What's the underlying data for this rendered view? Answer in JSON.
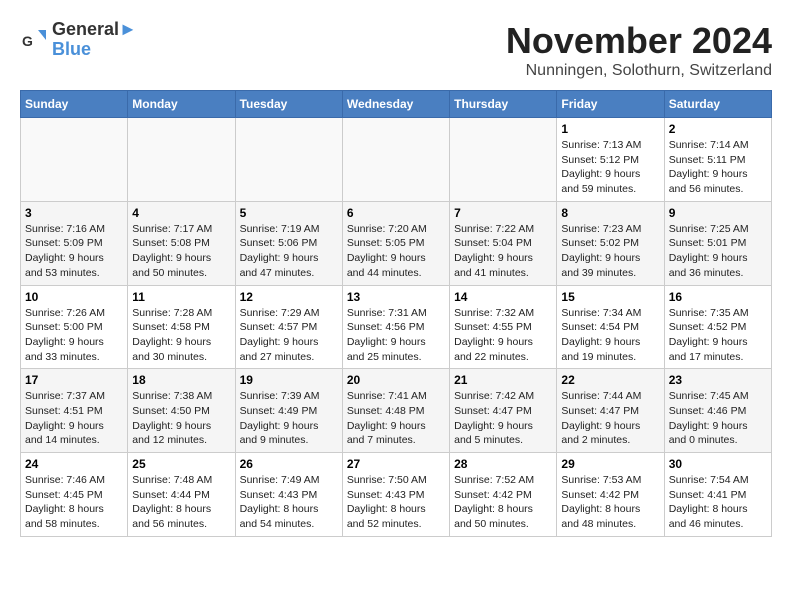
{
  "header": {
    "logo_line1": "General",
    "logo_line2": "Blue",
    "month": "November 2024",
    "location": "Nunningen, Solothurn, Switzerland"
  },
  "days_of_week": [
    "Sunday",
    "Monday",
    "Tuesday",
    "Wednesday",
    "Thursday",
    "Friday",
    "Saturday"
  ],
  "weeks": [
    [
      {
        "day": "",
        "info": ""
      },
      {
        "day": "",
        "info": ""
      },
      {
        "day": "",
        "info": ""
      },
      {
        "day": "",
        "info": ""
      },
      {
        "day": "",
        "info": ""
      },
      {
        "day": "1",
        "info": "Sunrise: 7:13 AM\nSunset: 5:12 PM\nDaylight: 9 hours and 59 minutes."
      },
      {
        "day": "2",
        "info": "Sunrise: 7:14 AM\nSunset: 5:11 PM\nDaylight: 9 hours and 56 minutes."
      }
    ],
    [
      {
        "day": "3",
        "info": "Sunrise: 7:16 AM\nSunset: 5:09 PM\nDaylight: 9 hours and 53 minutes."
      },
      {
        "day": "4",
        "info": "Sunrise: 7:17 AM\nSunset: 5:08 PM\nDaylight: 9 hours and 50 minutes."
      },
      {
        "day": "5",
        "info": "Sunrise: 7:19 AM\nSunset: 5:06 PM\nDaylight: 9 hours and 47 minutes."
      },
      {
        "day": "6",
        "info": "Sunrise: 7:20 AM\nSunset: 5:05 PM\nDaylight: 9 hours and 44 minutes."
      },
      {
        "day": "7",
        "info": "Sunrise: 7:22 AM\nSunset: 5:04 PM\nDaylight: 9 hours and 41 minutes."
      },
      {
        "day": "8",
        "info": "Sunrise: 7:23 AM\nSunset: 5:02 PM\nDaylight: 9 hours and 39 minutes."
      },
      {
        "day": "9",
        "info": "Sunrise: 7:25 AM\nSunset: 5:01 PM\nDaylight: 9 hours and 36 minutes."
      }
    ],
    [
      {
        "day": "10",
        "info": "Sunrise: 7:26 AM\nSunset: 5:00 PM\nDaylight: 9 hours and 33 minutes."
      },
      {
        "day": "11",
        "info": "Sunrise: 7:28 AM\nSunset: 4:58 PM\nDaylight: 9 hours and 30 minutes."
      },
      {
        "day": "12",
        "info": "Sunrise: 7:29 AM\nSunset: 4:57 PM\nDaylight: 9 hours and 27 minutes."
      },
      {
        "day": "13",
        "info": "Sunrise: 7:31 AM\nSunset: 4:56 PM\nDaylight: 9 hours and 25 minutes."
      },
      {
        "day": "14",
        "info": "Sunrise: 7:32 AM\nSunset: 4:55 PM\nDaylight: 9 hours and 22 minutes."
      },
      {
        "day": "15",
        "info": "Sunrise: 7:34 AM\nSunset: 4:54 PM\nDaylight: 9 hours and 19 minutes."
      },
      {
        "day": "16",
        "info": "Sunrise: 7:35 AM\nSunset: 4:52 PM\nDaylight: 9 hours and 17 minutes."
      }
    ],
    [
      {
        "day": "17",
        "info": "Sunrise: 7:37 AM\nSunset: 4:51 PM\nDaylight: 9 hours and 14 minutes."
      },
      {
        "day": "18",
        "info": "Sunrise: 7:38 AM\nSunset: 4:50 PM\nDaylight: 9 hours and 12 minutes."
      },
      {
        "day": "19",
        "info": "Sunrise: 7:39 AM\nSunset: 4:49 PM\nDaylight: 9 hours and 9 minutes."
      },
      {
        "day": "20",
        "info": "Sunrise: 7:41 AM\nSunset: 4:48 PM\nDaylight: 9 hours and 7 minutes."
      },
      {
        "day": "21",
        "info": "Sunrise: 7:42 AM\nSunset: 4:47 PM\nDaylight: 9 hours and 5 minutes."
      },
      {
        "day": "22",
        "info": "Sunrise: 7:44 AM\nSunset: 4:47 PM\nDaylight: 9 hours and 2 minutes."
      },
      {
        "day": "23",
        "info": "Sunrise: 7:45 AM\nSunset: 4:46 PM\nDaylight: 9 hours and 0 minutes."
      }
    ],
    [
      {
        "day": "24",
        "info": "Sunrise: 7:46 AM\nSunset: 4:45 PM\nDaylight: 8 hours and 58 minutes."
      },
      {
        "day": "25",
        "info": "Sunrise: 7:48 AM\nSunset: 4:44 PM\nDaylight: 8 hours and 56 minutes."
      },
      {
        "day": "26",
        "info": "Sunrise: 7:49 AM\nSunset: 4:43 PM\nDaylight: 8 hours and 54 minutes."
      },
      {
        "day": "27",
        "info": "Sunrise: 7:50 AM\nSunset: 4:43 PM\nDaylight: 8 hours and 52 minutes."
      },
      {
        "day": "28",
        "info": "Sunrise: 7:52 AM\nSunset: 4:42 PM\nDaylight: 8 hours and 50 minutes."
      },
      {
        "day": "29",
        "info": "Sunrise: 7:53 AM\nSunset: 4:42 PM\nDaylight: 8 hours and 48 minutes."
      },
      {
        "day": "30",
        "info": "Sunrise: 7:54 AM\nSunset: 4:41 PM\nDaylight: 8 hours and 46 minutes."
      }
    ]
  ]
}
